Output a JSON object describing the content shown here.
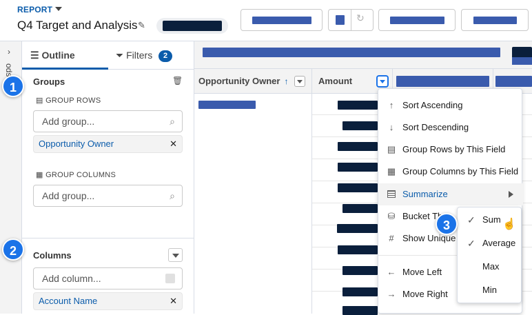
{
  "header": {
    "report_label": "REPORT",
    "title": "Q4 Target and Analysis"
  },
  "sidebar_strip": {
    "label": "ods"
  },
  "panel": {
    "tabs": [
      {
        "label": "Outline",
        "icon": "list-icon"
      },
      {
        "label": "Filters",
        "icon": "filter-icon",
        "badge": "2"
      }
    ],
    "groups": {
      "title": "Groups",
      "group_rows_label": "GROUP ROWS",
      "group_rows_placeholder": "Add group...",
      "group_rows_items": [
        "Opportunity Owner"
      ],
      "group_columns_label": "GROUP COLUMNS",
      "group_columns_placeholder": "Add group..."
    },
    "columns": {
      "title": "Columns",
      "placeholder": "Add column...",
      "items": [
        "Account Name"
      ]
    }
  },
  "table": {
    "columns": [
      {
        "label": "Opportunity Owner",
        "sort": "↑"
      },
      {
        "label": "Amount"
      }
    ]
  },
  "column_menu": {
    "items": [
      {
        "label": "Sort Ascending",
        "icon": "arrow-up-icon"
      },
      {
        "label": "Sort Descending",
        "icon": "arrow-down-icon"
      },
      {
        "label": "Group Rows by This Field",
        "icon": "group-rows-icon"
      },
      {
        "label": "Group Columns by This Field",
        "icon": "group-columns-icon"
      },
      {
        "label": "Summarize",
        "icon": "summarize-icon",
        "highlighted": true,
        "has_submenu": true
      },
      {
        "label": "Bucket Th",
        "icon": "bucket-icon"
      },
      {
        "label": "Show Unique",
        "icon": "hash-icon"
      },
      {
        "label": "Move Left",
        "icon": "arrow-left-icon"
      },
      {
        "label": "Move Right",
        "icon": "arrow-right-icon"
      }
    ]
  },
  "summarize_submenu": {
    "items": [
      {
        "label": "Sum",
        "checked": true
      },
      {
        "label": "Average",
        "checked": true
      },
      {
        "label": "Max",
        "checked": false
      },
      {
        "label": "Min",
        "checked": false
      }
    ]
  },
  "steps": [
    "1",
    "2",
    "3"
  ],
  "colors": {
    "accent": "#0b5cab",
    "step_badge": "#1b73e8",
    "redacted_light": "#3a5bad",
    "redacted_dark": "#0a1f3c"
  }
}
